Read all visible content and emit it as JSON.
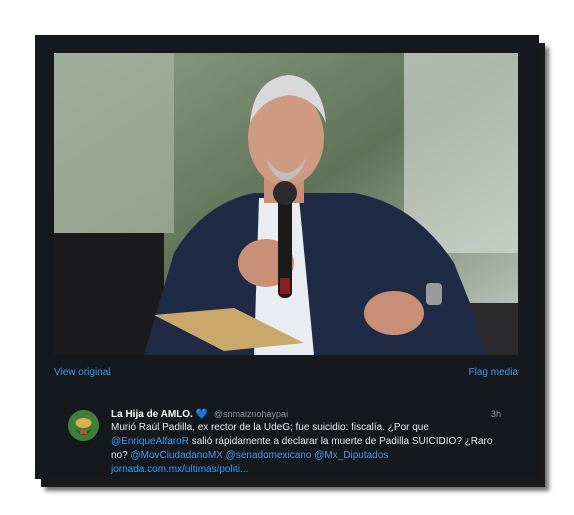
{
  "media": {
    "view_original": "View original",
    "flag_media": "Flag media"
  },
  "tweet": {
    "display_name": "La Hija de AMLO.",
    "heart": "💙",
    "handle": "@snmaiznohaypai",
    "time": "3h",
    "text_1": "Murió Raúl Padilla, ex rector de la UdeG; fue suicidio: fiscalía. ¿Por que",
    "mention_enrique": "@EnriqueAlfaroR",
    "text_2": " salió rápidamente a declarar la muerte de Padilla SUICIDIO? ¿Raro no? ",
    "mention_mov": "@MovCiudadanoMX",
    "mention_senado": "@senadomexicano",
    "mention_diputados": "@Mx_Diputados",
    "url": "jornada.com.mx/ultimas/politi..."
  },
  "colors": {
    "card_bg": "#15181d",
    "link": "#3f9cf0",
    "muted": "#8b949e"
  }
}
